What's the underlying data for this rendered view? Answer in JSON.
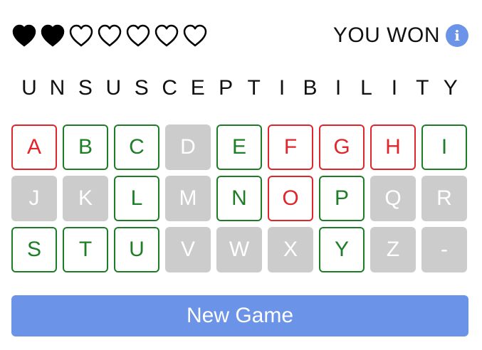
{
  "lives": {
    "total": 7,
    "remaining": 2,
    "filled_color": "#000000"
  },
  "status": {
    "text": "YOU WON",
    "info_icon": "info-icon",
    "info_symbol": "i",
    "info_color": "#6b93e8"
  },
  "word": [
    "U",
    "N",
    "S",
    "U",
    "S",
    "C",
    "E",
    "P",
    "T",
    "I",
    "B",
    "I",
    "L",
    "I",
    "T",
    "Y"
  ],
  "keyboard": [
    {
      "letter": "A",
      "state": "wrong"
    },
    {
      "letter": "B",
      "state": "correct"
    },
    {
      "letter": "C",
      "state": "correct"
    },
    {
      "letter": "D",
      "state": "unused"
    },
    {
      "letter": "E",
      "state": "correct"
    },
    {
      "letter": "F",
      "state": "wrong"
    },
    {
      "letter": "G",
      "state": "wrong"
    },
    {
      "letter": "H",
      "state": "wrong"
    },
    {
      "letter": "I",
      "state": "correct"
    },
    {
      "letter": "J",
      "state": "unused"
    },
    {
      "letter": "K",
      "state": "unused"
    },
    {
      "letter": "L",
      "state": "correct"
    },
    {
      "letter": "M",
      "state": "unused"
    },
    {
      "letter": "N",
      "state": "correct"
    },
    {
      "letter": "O",
      "state": "wrong"
    },
    {
      "letter": "P",
      "state": "correct"
    },
    {
      "letter": "Q",
      "state": "unused"
    },
    {
      "letter": "R",
      "state": "unused"
    },
    {
      "letter": "S",
      "state": "correct"
    },
    {
      "letter": "T",
      "state": "correct"
    },
    {
      "letter": "U",
      "state": "correct"
    },
    {
      "letter": "V",
      "state": "unused"
    },
    {
      "letter": "W",
      "state": "unused"
    },
    {
      "letter": "X",
      "state": "unused"
    },
    {
      "letter": "Y",
      "state": "correct"
    },
    {
      "letter": "Z",
      "state": "unused"
    },
    {
      "letter": "-",
      "state": "unused"
    }
  ],
  "colors": {
    "correct": "#1e7e27",
    "wrong": "#e0262d",
    "unused": "#cccccc",
    "accent": "#6b93e8"
  },
  "new_game_label": "New Game"
}
